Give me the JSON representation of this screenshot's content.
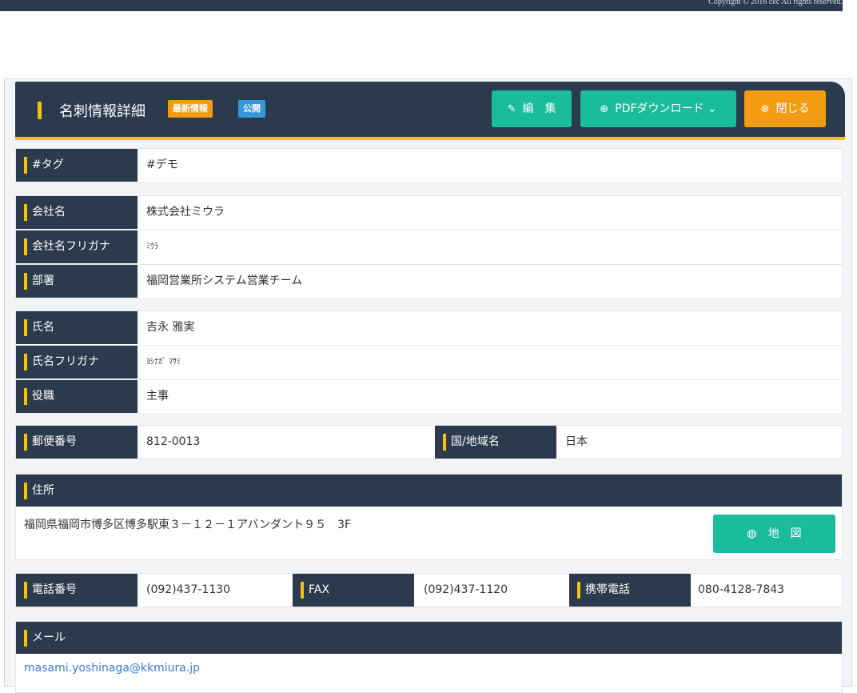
{
  "footer": {
    "copyright": "Copyright © 2016 cec All rights reserved."
  },
  "header": {
    "title": "名刺情報詳細",
    "badge_latest": "最新情報",
    "badge_public": "公開",
    "edit_label": "編　集",
    "pdf_label": "PDFダウンロード ",
    "pdf_caret": "⌄",
    "close_label": "閉じる"
  },
  "fields": {
    "tag": {
      "label": "#タグ",
      "value": "#デモ"
    },
    "company": {
      "label": "会社名",
      "value": "株式会社ミウラ"
    },
    "company_kana": {
      "label": "会社名フリガナ",
      "value": "ﾐｳﾗ"
    },
    "department": {
      "label": "部署",
      "value": "福岡営業所システム営業チーム"
    },
    "name": {
      "label": "氏名",
      "value": "吉永 雅実"
    },
    "name_kana": {
      "label": "氏名フリガナ",
      "value": "ﾖｼﾅｶﾞ ﾏｻﾐ"
    },
    "position": {
      "label": "役職",
      "value": "主事"
    },
    "postal": {
      "label": "郵便番号",
      "value": "812-0013"
    },
    "country": {
      "label": "国/地域名",
      "value": "日本"
    },
    "address": {
      "label": "住所",
      "value": "福岡県福岡市博多区博多駅東３－１２－１アバンダント９５　3F",
      "map_label": "地　図"
    },
    "phone": {
      "label": "電話番号",
      "value": "(092)437-1130"
    },
    "fax": {
      "label": "FAX",
      "value": "(092)437-1120"
    },
    "mobile": {
      "label": "携帯電話",
      "value": "080-4128-7843"
    },
    "email": {
      "label": "メール",
      "value": "masami.yoshinaga@kkmiura.jp"
    }
  },
  "icons": {
    "edit": "pencil-icon",
    "pdf": "download-circle-icon",
    "close": "close-circle-icon",
    "map": "globe-icon"
  },
  "colors": {
    "navy": "#2b3a4d",
    "yellow_accent": "#f4c20d",
    "teal_button": "#1abc9c",
    "orange_button": "#f39c12",
    "blue_badge": "#3498db"
  }
}
